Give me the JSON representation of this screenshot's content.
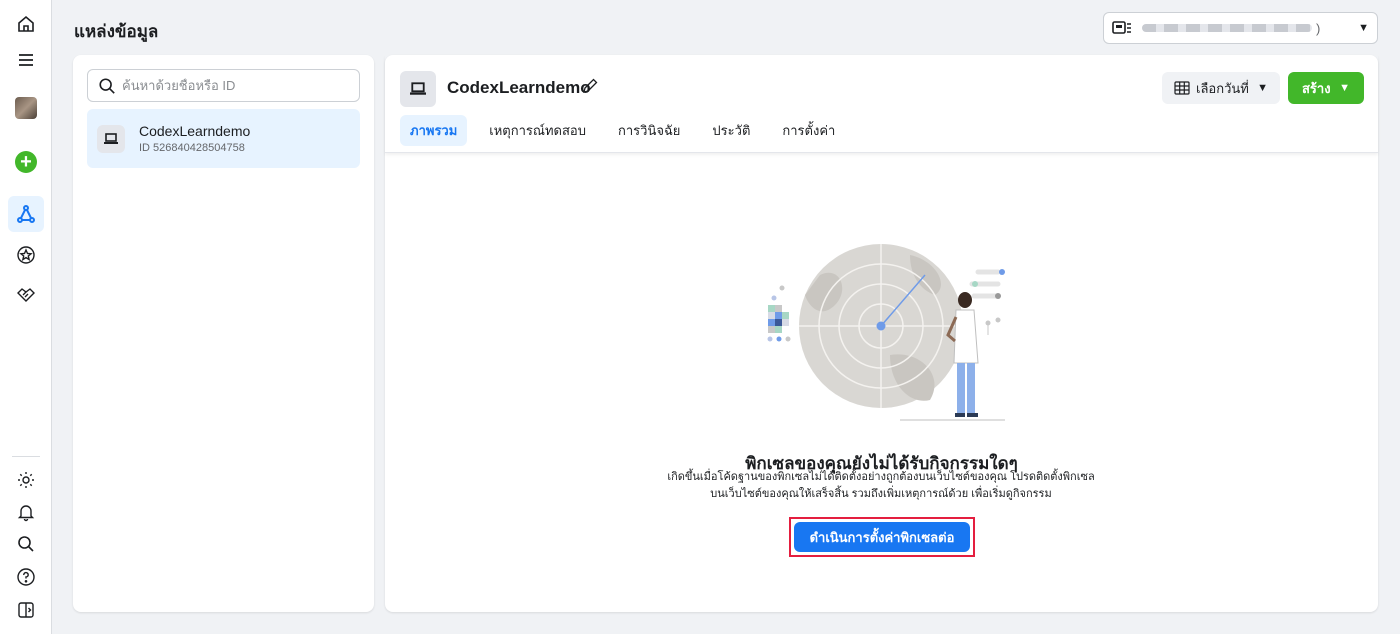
{
  "header": {
    "title": "แหล่งข้อมูล",
    "account_suffix": ")"
  },
  "rail": {
    "icons": [
      "home-icon",
      "menu-icon",
      "avatar",
      "create-plus-icon",
      "events-manager-icon",
      "star-circle-icon",
      "partners-handshake-icon",
      "settings-icon",
      "notifications-bell-icon",
      "search-icon",
      "help-icon",
      "collapse-panel-icon"
    ]
  },
  "left_panel": {
    "search_placeholder": "ค้นหาด้วยชื่อหรือ ID",
    "sources": [
      {
        "name": "CodexLearndemo",
        "id": "ID 526840428504758"
      }
    ]
  },
  "pixel": {
    "name": "CodexLearndemo",
    "date_button": "เลือกวันที่",
    "create_button": "สร้าง",
    "tabs": [
      "ภาพรวม",
      "เหตุการณ์ทดสอบ",
      "การวินิจฉัย",
      "ประวัติ",
      "การตั้งค่า"
    ],
    "active_tab": "ภาพรวม"
  },
  "empty_state": {
    "title": "พิกเซลของคุณยังไม่ได้รับกิจกรรมใดๆ",
    "desc_line1": "เกิดขึ้นเมื่อโค้ดฐานของพิกเซลไม่ได้ติดตั้งอย่างถูกต้องบนเว็บไซต์ของคุณ โปรดติดตั้งพิกเซล",
    "desc_line2": "บนเว็บไซต์ของคุณให้เสร็จสิ้น รวมถึงเพิ่มเหตุการณ์ด้วย เพื่อเริ่มดูกิจกรรม",
    "cta": "ดำเนินการตั้งค่าพิกเซลต่อ"
  },
  "colors": {
    "primary": "#1877f2",
    "create_green": "#42b72a",
    "highlight_red": "#e41e3f",
    "selected_bg": "#e7f3ff"
  }
}
